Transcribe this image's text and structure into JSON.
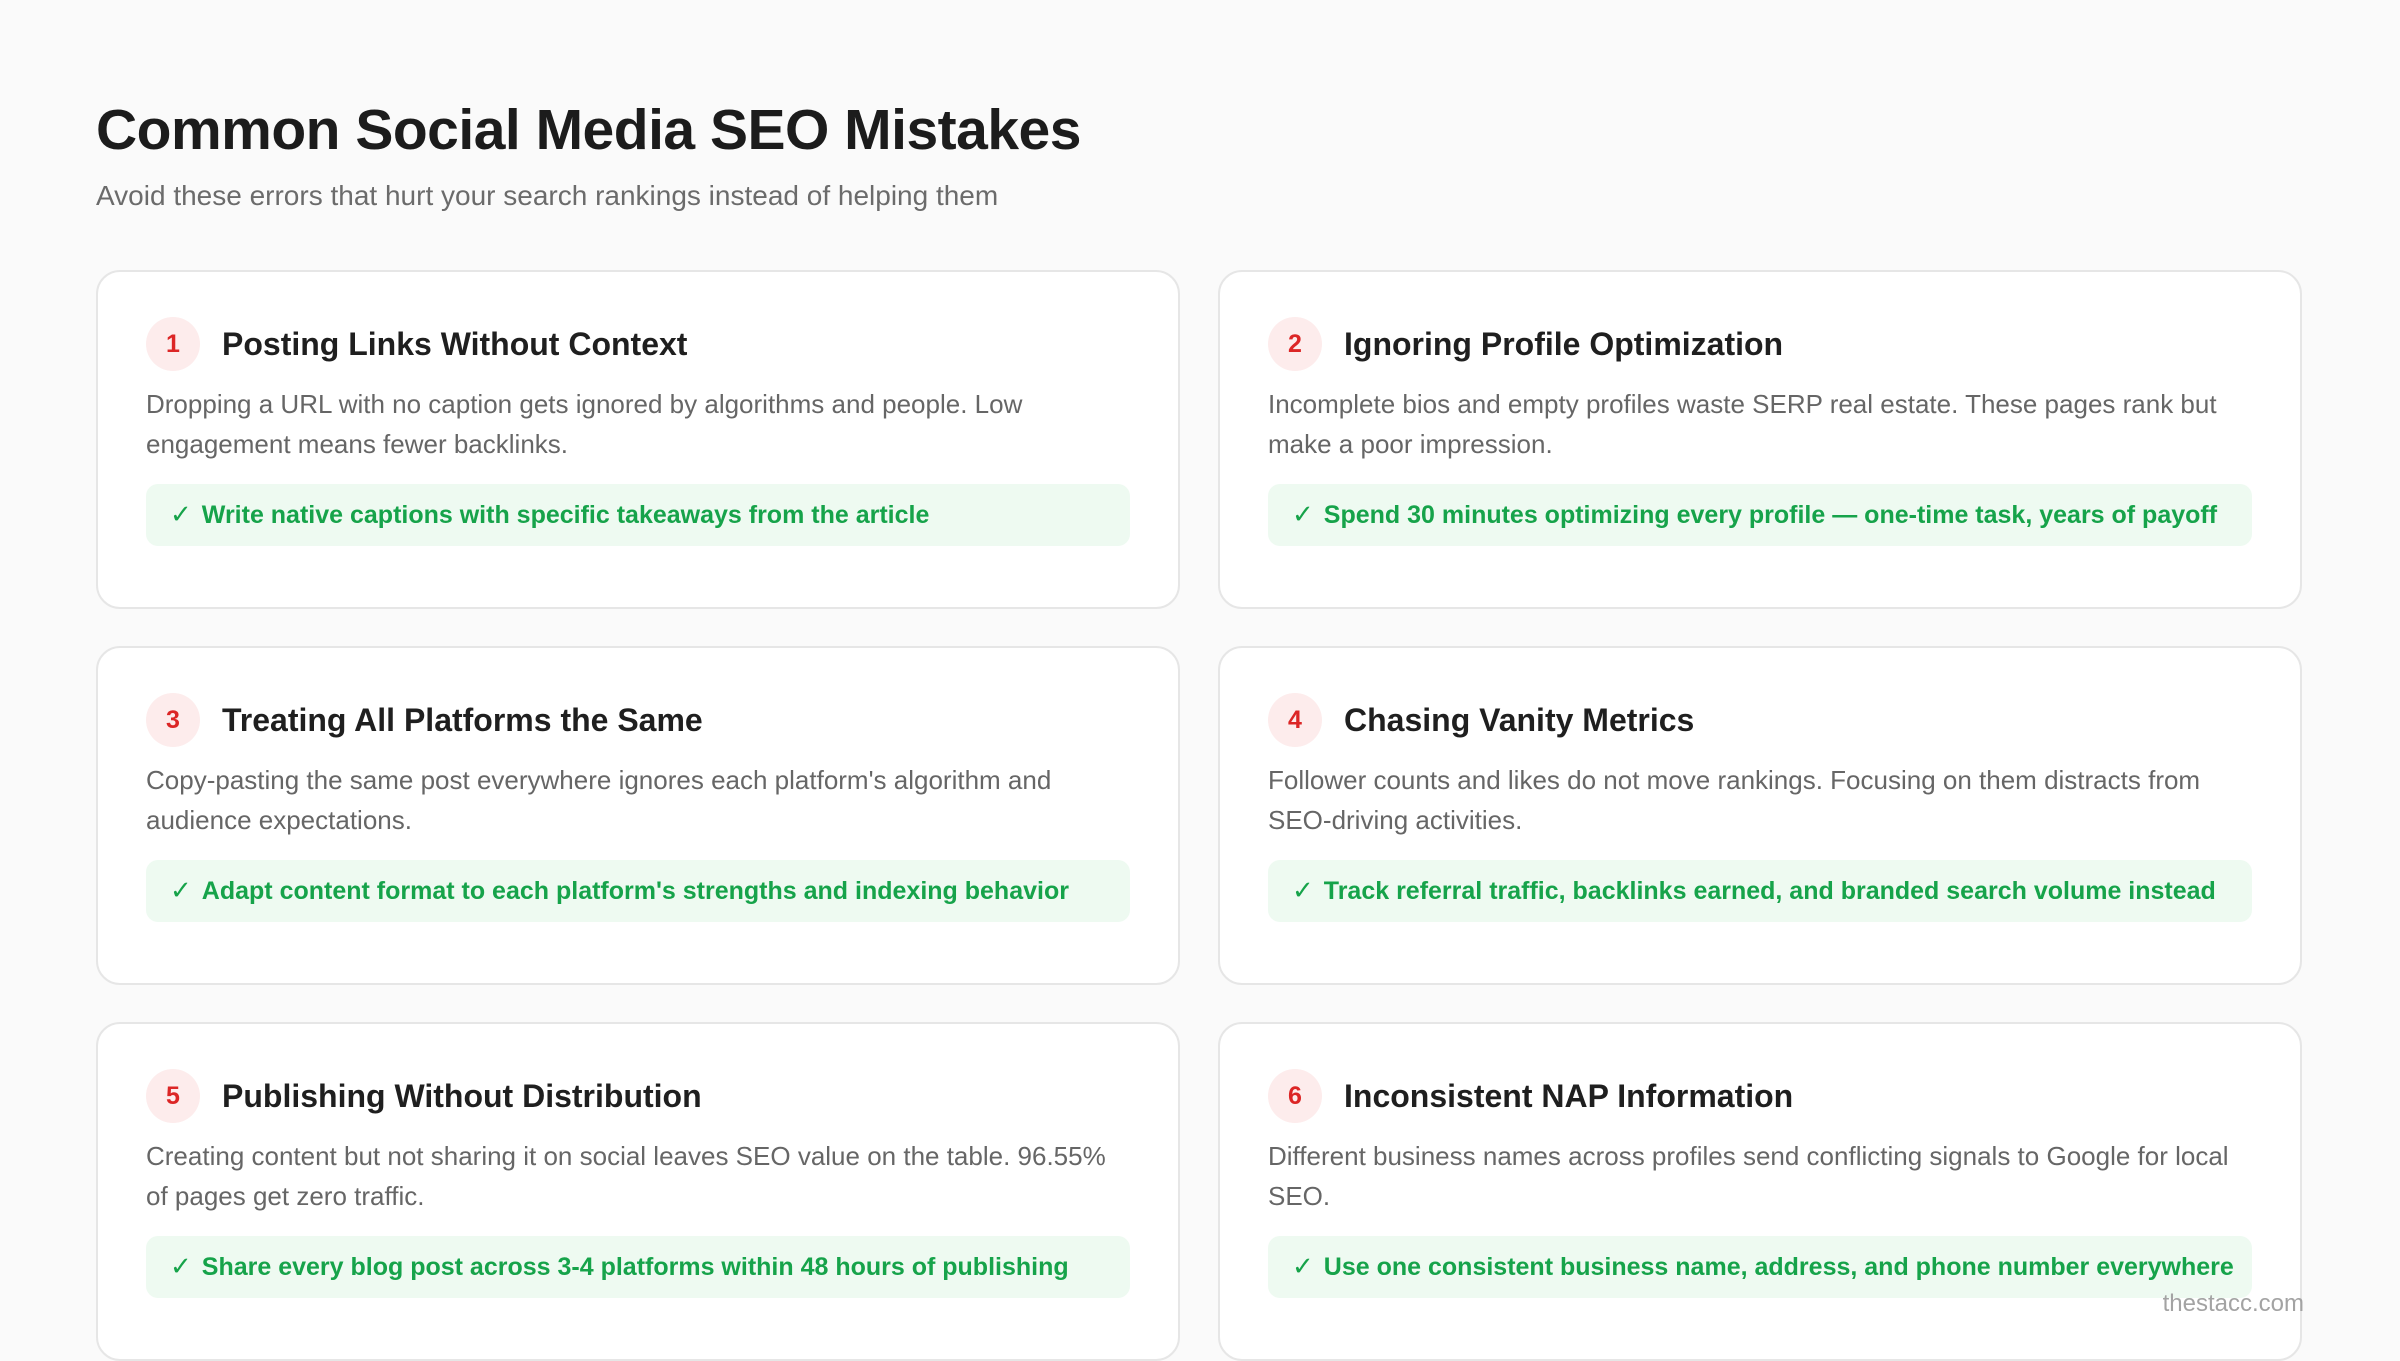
{
  "header": {
    "title": "Common Social Media SEO Mistakes",
    "subtitle": "Avoid these errors that hurt your search rankings instead of helping them"
  },
  "colors": {
    "number_badge_bg": "#fdecec",
    "number_text": "#dc2626",
    "fix_bg": "#eefaf1",
    "fix_text": "#16a34a"
  },
  "check_icon": "check-mark",
  "check_glyph": "✓",
  "cards": [
    {
      "number": "1",
      "title": "Posting Links Without Context",
      "description": "Dropping a URL with no caption gets ignored by algorithms and people. Low engagement means fewer backlinks.",
      "fix": "Write native captions with specific takeaways from the article"
    },
    {
      "number": "2",
      "title": "Ignoring Profile Optimization",
      "description": "Incomplete bios and empty profiles waste SERP real estate. These pages rank but make a poor impression.",
      "fix": "Spend 30 minutes optimizing every profile — one-time task, years of payoff"
    },
    {
      "number": "3",
      "title": "Treating All Platforms the Same",
      "description": "Copy-pasting the same post everywhere ignores each platform's algorithm and audience expectations.",
      "fix": "Adapt content format to each platform's strengths and indexing behavior"
    },
    {
      "number": "4",
      "title": "Chasing Vanity Metrics",
      "description": "Follower counts and likes do not move rankings. Focusing on them distracts from SEO-driving activities.",
      "fix": "Track referral traffic, backlinks earned, and branded search volume instead"
    },
    {
      "number": "5",
      "title": "Publishing Without Distribution",
      "description": "Creating content but not sharing it on social leaves SEO value on the table. 96.55% of pages get zero traffic.",
      "fix": "Share every blog post across 3-4 platforms within 48 hours of publishing"
    },
    {
      "number": "6",
      "title": "Inconsistent NAP Information",
      "description": "Different business names across profiles send conflicting signals to Google for local SEO.",
      "fix": "Use one consistent business name, address, and phone number everywhere"
    }
  ],
  "watermark": "thestacc.com"
}
